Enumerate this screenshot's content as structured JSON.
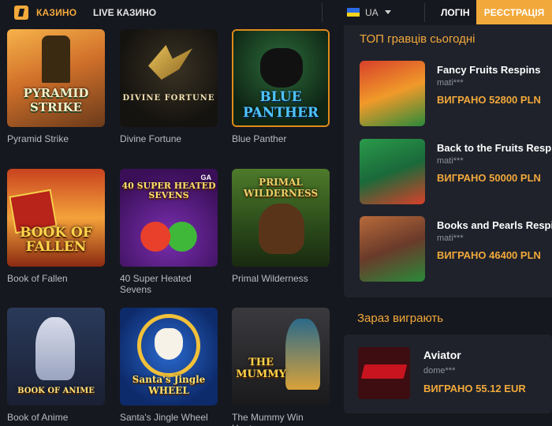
{
  "header": {
    "casino_label": "КАЗИНО",
    "live_casino_label": "LIVE КАЗИНО",
    "language": "UA",
    "login_label": "ЛОГІН",
    "register_label": "РЕЄСТРАЦІЯ"
  },
  "colors": {
    "accent": "#f2a93b",
    "background": "#16181f",
    "panel": "#1f222b"
  },
  "games": [
    {
      "title": "Pyramid Strike",
      "art": "PYRAMID STRIKE"
    },
    {
      "title": "Divine Fortune",
      "art": "DIVINE FORTUNE"
    },
    {
      "title": "Blue Panther",
      "art": "BLUE PANTHER"
    },
    {
      "title": "Book of Fallen",
      "art": "BOOK OF FALLEN"
    },
    {
      "title": "40 Super Heated Sevens",
      "art": "40 SUPER HEATED SEVENS"
    },
    {
      "title": "Primal Wilderness",
      "art": "PRIMAL WILDERNESS"
    },
    {
      "title": "Book of Anime",
      "art": "BOOK OF ANIME"
    },
    {
      "title": "Santa's Jingle Wheel",
      "art": "Santa's Jingle WHEEL"
    },
    {
      "title": "The Mummy Win Hunters",
      "art": "THE MUMMY"
    }
  ],
  "top_players": {
    "title": "ТОП гравців сьогодні",
    "items": [
      {
        "game": "Fancy Fruits Respins",
        "user": "mati***",
        "amount": "ВИГРАНО 52800 PLN"
      },
      {
        "game": "Back to the Fruits Respins",
        "user": "mati***",
        "amount": "ВИГРАНО 50000 PLN"
      },
      {
        "game": "Books and Pearls Respins",
        "user": "mati***",
        "amount": "ВИГРАНО 46400 PLN"
      }
    ]
  },
  "now_winning": {
    "title": "Зараз виграють",
    "game": "Aviator",
    "user": "dome***",
    "amount": "ВИГРАНО 55.12 EUR"
  }
}
